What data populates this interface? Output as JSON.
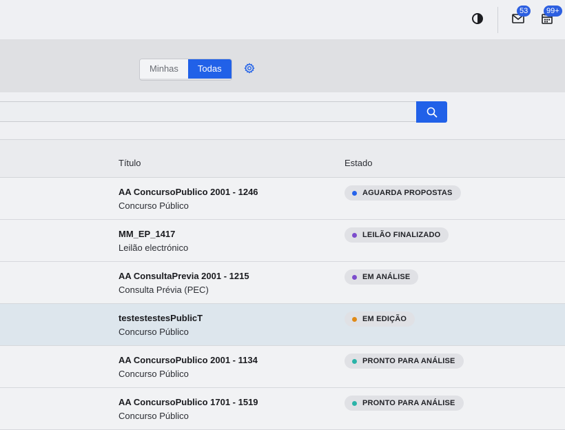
{
  "topbar": {
    "contrast_icon": "contrast-icon",
    "mail_icon": "mail-icon",
    "mail_count": "53",
    "calendar_icon": "calendar-icon",
    "calendar_count": "99+"
  },
  "filter": {
    "options": [
      "Minhas",
      "Todas"
    ],
    "selected": "Todas",
    "settings_icon": "gear-icon"
  },
  "search": {
    "value": "",
    "button_icon": "search-icon"
  },
  "table": {
    "columns": [
      "Título",
      "Estado"
    ],
    "rows": [
      {
        "title": "AA ConcursoPublico 2001 - 1246",
        "subtitle": "Concurso Público",
        "status": "AGUARDA PROPOSTAS",
        "status_color": "#2563eb",
        "highlighted": false
      },
      {
        "title": "MM_EP_1417",
        "subtitle": "Leilão electrónico",
        "status": "LEILÃO FINALIZADO",
        "status_color": "#7c4dcc",
        "highlighted": false
      },
      {
        "title": "AA ConsultaPrevia 2001 - 1215",
        "subtitle": "Consulta Prévia (PEC)",
        "status": "EM ANÁLISE",
        "status_color": "#7c4dcc",
        "highlighted": false
      },
      {
        "title": "testestestesPublicT",
        "subtitle": "Concurso Público",
        "status": "EM EDIÇÃO",
        "status_color": "#e08a17",
        "highlighted": true
      },
      {
        "title": "AA ConcursoPublico 2001 - 1134",
        "subtitle": "Concurso Público",
        "status": "PRONTO PARA ANÁLISE",
        "status_color": "#2ab3a8",
        "highlighted": false
      },
      {
        "title": "AA ConcursoPublico 1701 - 1519",
        "subtitle": "Concurso Público",
        "status": "PRONTO PARA ANÁLISE",
        "status_color": "#2ab3a8",
        "highlighted": false
      }
    ]
  },
  "colors": {
    "accent": "#2161e8",
    "badge": "#2d5fe0"
  }
}
